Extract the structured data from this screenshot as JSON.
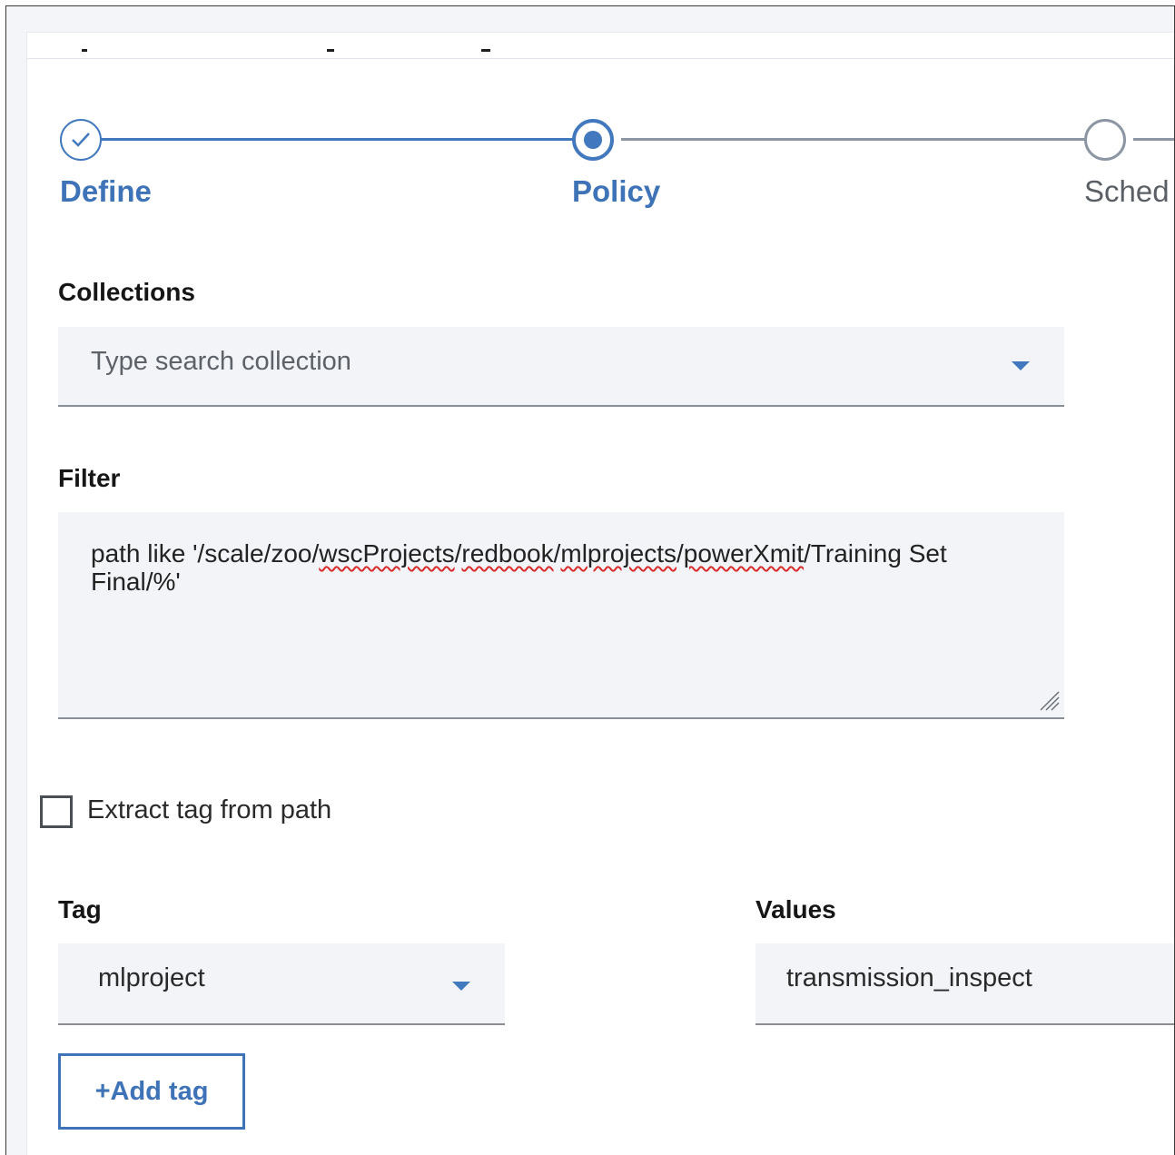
{
  "progress": {
    "steps": [
      {
        "label": "Define",
        "status": "complete"
      },
      {
        "label": "Policy",
        "status": "current"
      },
      {
        "label": "Sched",
        "status": "incomplete"
      }
    ]
  },
  "collections": {
    "label": "Collections",
    "placeholder": "Type search collection",
    "icon": "chevron-down-icon"
  },
  "filter": {
    "label": "Filter",
    "value_parts": [
      "path like '/scale/zoo/",
      "wscProjects",
      "/",
      "redbook",
      "/",
      "mlprojects",
      "/",
      "powerXmit",
      "/Training Set Final/%'"
    ]
  },
  "extract_tag": {
    "label": "Extract tag from path",
    "checked": false
  },
  "tag": {
    "label": "Tag",
    "value": "mlproject",
    "icon": "chevron-down-icon"
  },
  "values": {
    "label": "Values",
    "value": "transmission_inspect"
  },
  "add_tag_button": {
    "label": "+Add tag"
  },
  "colors": {
    "accent": "#4178be",
    "field_bg": "#f2f4f8",
    "inactive": "#8c96a3",
    "spellcheck": "#d92b2b"
  }
}
